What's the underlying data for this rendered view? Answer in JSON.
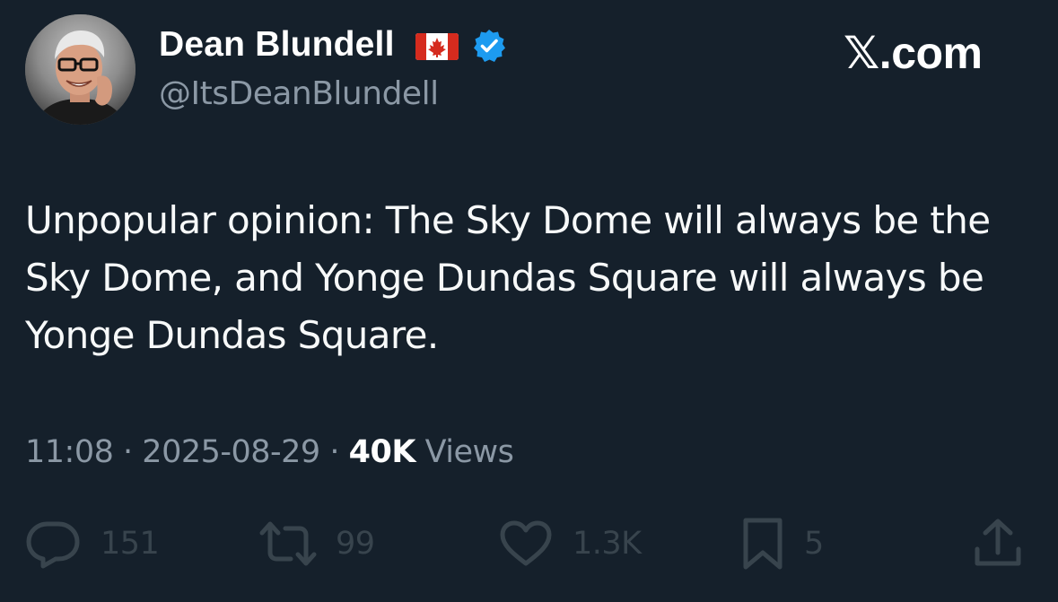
{
  "author": {
    "display_name": "Dean Blundell",
    "handle": "@ItsDeanBlundell"
  },
  "brand": {
    "x_glyph": "𝕏",
    "domain_suffix": ".com"
  },
  "tweet": {
    "text": "Unpopular opinion: The Sky Dome will always be the Sky Dome, and Yonge Dundas Square will always be Yonge Dundas Square."
  },
  "meta": {
    "time": "11:08",
    "separator": "·",
    "date": "2025-08-29",
    "views_count": "40K",
    "views_label": "Views"
  },
  "actions": {
    "replies": "151",
    "reposts": "99",
    "likes": "1.3K",
    "bookmarks": "5"
  },
  "icons": {
    "flag": "canada-flag-icon",
    "verified": "verified-badge-icon",
    "reply": "reply-icon",
    "repost": "repost-icon",
    "like": "heart-icon",
    "bookmark": "bookmark-icon",
    "share": "share-icon"
  },
  "colors": {
    "background": "#15202b",
    "text": "#e7e9ea",
    "muted": "#8b98a5",
    "verified": "#1d9bf0",
    "flag_red": "#d52b1e",
    "action_icon": "#38444d"
  }
}
